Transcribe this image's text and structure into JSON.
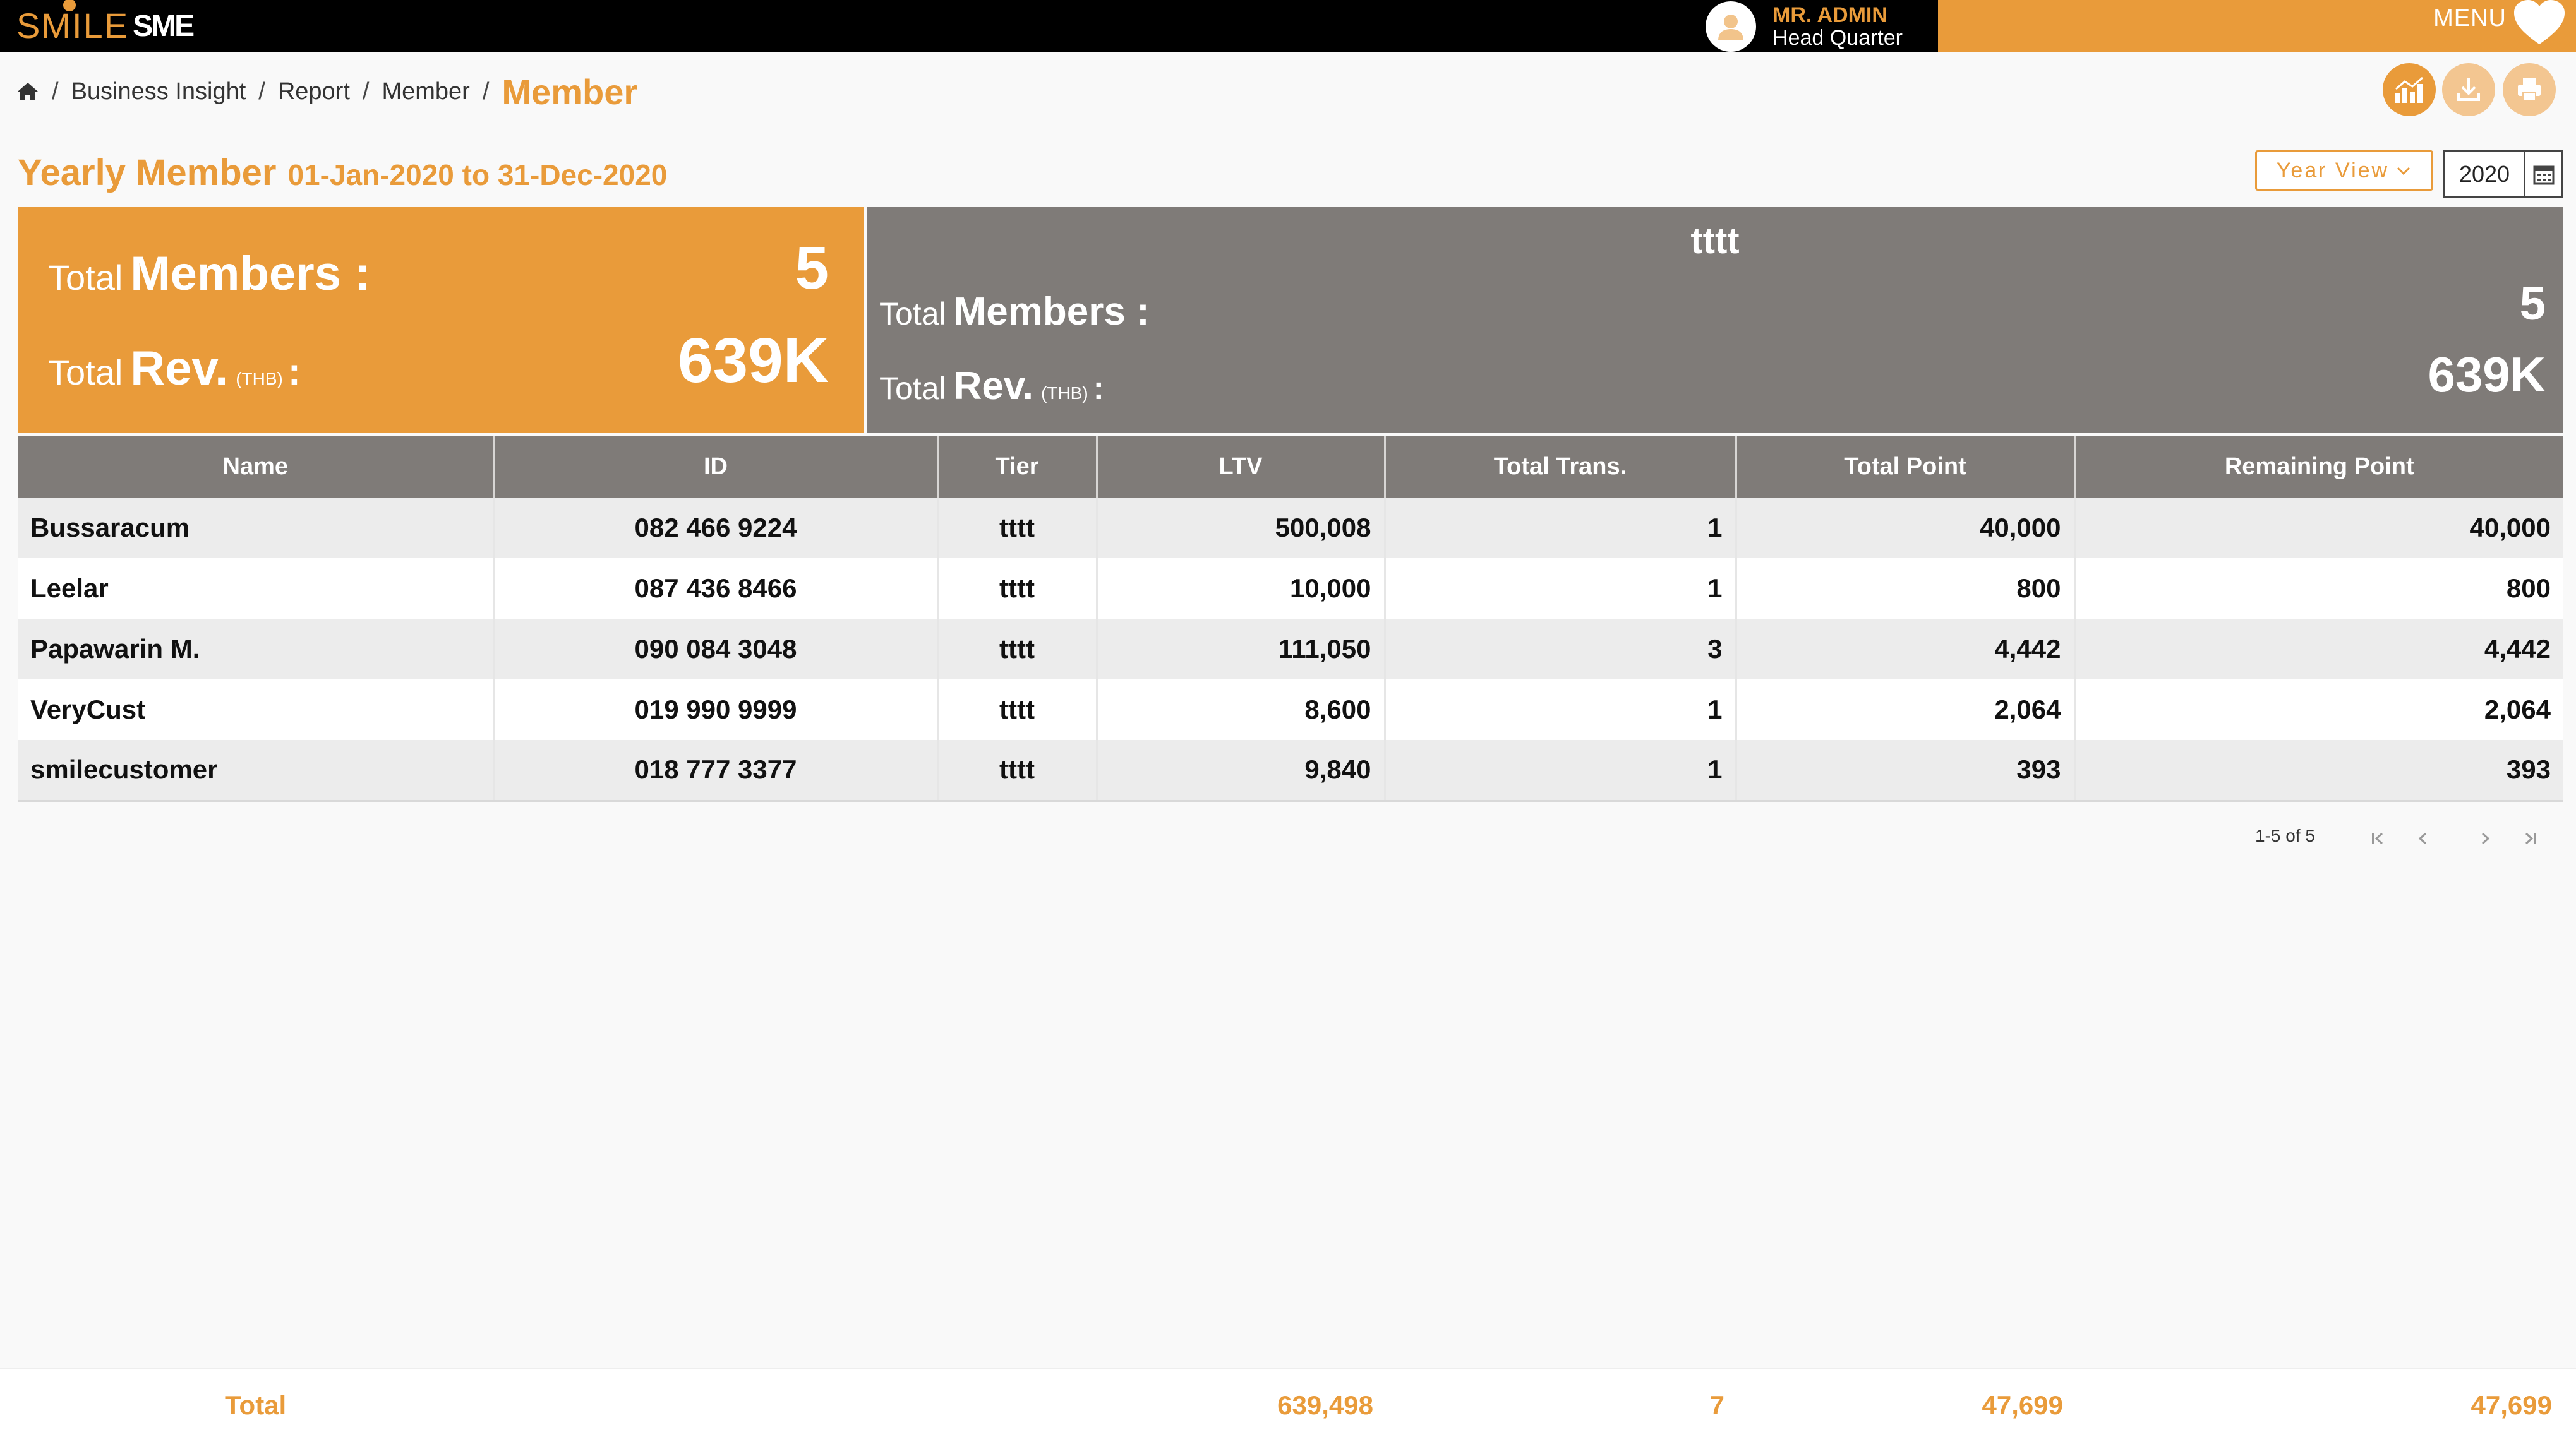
{
  "app": {
    "logo_primary": "SMILE",
    "logo_secondary": "SME",
    "user_name": "MR. ADMIN",
    "user_branch": "Head Quarter",
    "menu_label": "MENU",
    "accent_color": "#e99b3a",
    "panel_gray": "#7f7b78"
  },
  "breadcrumb": {
    "items": [
      "Business Insight",
      "Report",
      "Member"
    ],
    "current": "Member"
  },
  "actions": {
    "icons": [
      "chart-icon",
      "download-icon",
      "print-icon"
    ]
  },
  "heading": {
    "title": "Yearly Member",
    "range": "01-Jan-2020 to 31-Dec-2020"
  },
  "filters": {
    "view_mode": "Year View",
    "year": "2020"
  },
  "summary": {
    "total_label": "Total",
    "members_label": "Members :",
    "rev_label": "Rev.",
    "rev_unit": "(THB)",
    "colon": ":",
    "total_members": "5",
    "total_rev": "639K"
  },
  "tier_card": {
    "name": "tttt",
    "members": "5",
    "rev": "639K"
  },
  "table": {
    "columns": [
      "Name",
      "ID",
      "Tier",
      "LTV",
      "Total Trans.",
      "Total Point",
      "Remaining Point"
    ],
    "rows": [
      {
        "name": "Bussaracum",
        "id": "082 466 9224",
        "tier": "tttt",
        "ltv": "500,008",
        "trans": "1",
        "total_point": "40,000",
        "remaining_point": "40,000"
      },
      {
        "name": "Leelar",
        "id": "087 436 8466",
        "tier": "tttt",
        "ltv": "10,000",
        "trans": "1",
        "total_point": "800",
        "remaining_point": "800"
      },
      {
        "name": "Papawarin M.",
        "id": "090 084 3048",
        "tier": "tttt",
        "ltv": "111,050",
        "trans": "3",
        "total_point": "4,442",
        "remaining_point": "4,442"
      },
      {
        "name": "VeryCust",
        "id": "019 990 9999",
        "tier": "tttt",
        "ltv": "8,600",
        "trans": "1",
        "total_point": "2,064",
        "remaining_point": "2,064"
      },
      {
        "name": "smilecustomer",
        "id": "018 777 3377",
        "tier": "tttt",
        "ltv": "9,840",
        "trans": "1",
        "total_point": "393",
        "remaining_point": "393"
      }
    ]
  },
  "pagination": {
    "range_text": "1-5 of 5"
  },
  "footer": {
    "label": "Total",
    "ltv": "639,498",
    "trans": "7",
    "total_point": "47,699",
    "remaining_point": "47,699"
  }
}
